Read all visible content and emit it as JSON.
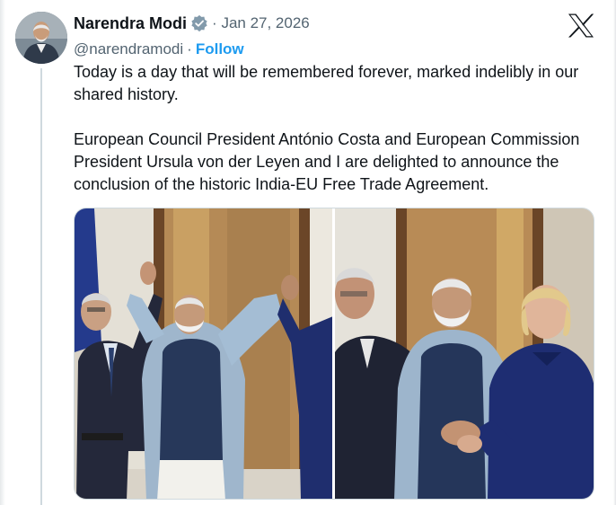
{
  "post": {
    "author_name": "Narendra Modi",
    "verified_icon": "verified-badge-icon",
    "date": "Jan 27, 2026",
    "date_prefix": "·",
    "handle": "@narendramodi",
    "handle_sep": "·",
    "follow_label": "Follow",
    "platform_icon": "x-logo-icon",
    "text_paragraphs": [
      "Today is a day that will be remembered forever, marked indelibly in our shared history.",
      "European Council President António Costa and European Commission President Ursula von der Leyen and I are delighted to announce the conclusion of the historic India-EU Free Trade Agreement."
    ]
  },
  "media": {
    "photos": [
      {
        "name": "photo-leaders-raised-hands"
      },
      {
        "name": "photo-leaders-joined-hands"
      }
    ]
  },
  "colors": {
    "link_blue": "#1d9bf0",
    "secondary_text": "#536471",
    "primary_text": "#0f1419",
    "verified_gray": "#829aab"
  }
}
